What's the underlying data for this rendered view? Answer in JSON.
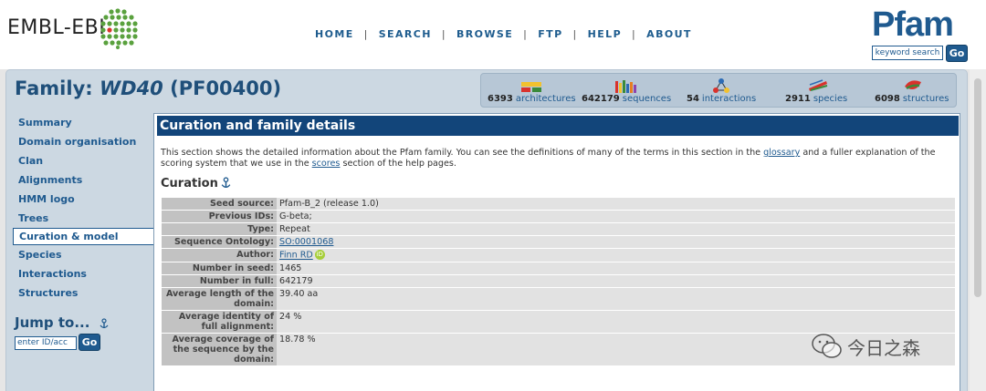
{
  "header": {
    "ebi_logo_text": "EMBL-EBI",
    "nav": [
      "HOME",
      "SEARCH",
      "BROWSE",
      "FTP",
      "HELP",
      "ABOUT"
    ],
    "separator": "|",
    "pfam_logo_text": "Pfam",
    "keyword_search_placeholder": "keyword search",
    "go_label": "Go"
  },
  "family": {
    "prefix": "Family:",
    "name": "WD40",
    "accession": "(PF00400)"
  },
  "stats": [
    {
      "count": "6393",
      "label": "architectures",
      "icon": "architectures-icon"
    },
    {
      "count": "642179",
      "label": "sequences",
      "icon": "sequences-icon"
    },
    {
      "count": "54",
      "label": "interactions",
      "icon": "interactions-icon"
    },
    {
      "count": "2911",
      "label": "species",
      "icon": "species-icon"
    },
    {
      "count": "6098",
      "label": "structures",
      "icon": "structures-icon"
    }
  ],
  "sidebar": {
    "items": [
      "Summary",
      "Domain organisation",
      "Clan",
      "Alignments",
      "HMM logo",
      "Trees",
      "Curation & model",
      "Species",
      "Interactions",
      "Structures"
    ],
    "active_index": 6,
    "jump_title": "Jump to...",
    "jump_placeholder": "enter ID/acc",
    "jump_go": "Go"
  },
  "panel": {
    "heading": "Curation and family details",
    "intro_before_glossary": "This section shows the detailed information about the Pfam family. You can see the definitions of many of the terms in this section in the ",
    "glossary_link": "glossary",
    "intro_middle": " and a fuller explanation of the scoring system that we use in the ",
    "scores_link": "scores",
    "intro_end": " section of the help pages.",
    "curation_heading": "Curation"
  },
  "curation": [
    {
      "label": "Seed source:",
      "value": "Pfam-B_2 (release 1.0)"
    },
    {
      "label": "Previous IDs:",
      "value": "G-beta;"
    },
    {
      "label": "Type:",
      "value": "Repeat"
    },
    {
      "label": "Sequence Ontology:",
      "value": "SO:0001068"
    },
    {
      "label": "Author:",
      "value": "Finn RD"
    },
    {
      "label": "Number in seed:",
      "value": "1465"
    },
    {
      "label": "Number in full:",
      "value": "642179"
    },
    {
      "label": "Average length of the domain:",
      "value": "39.40 aa"
    },
    {
      "label": "Average identity of full alignment:",
      "value": "24 %"
    },
    {
      "label": "Average coverage of the sequence by the domain:",
      "value": "18.78 %"
    }
  ],
  "orcid_label": "iD",
  "watermark": "今日之森",
  "colors": {
    "brand_blue": "#1f5a8f",
    "panel_header": "#12457a",
    "main_bg": "#ccd8e2"
  }
}
